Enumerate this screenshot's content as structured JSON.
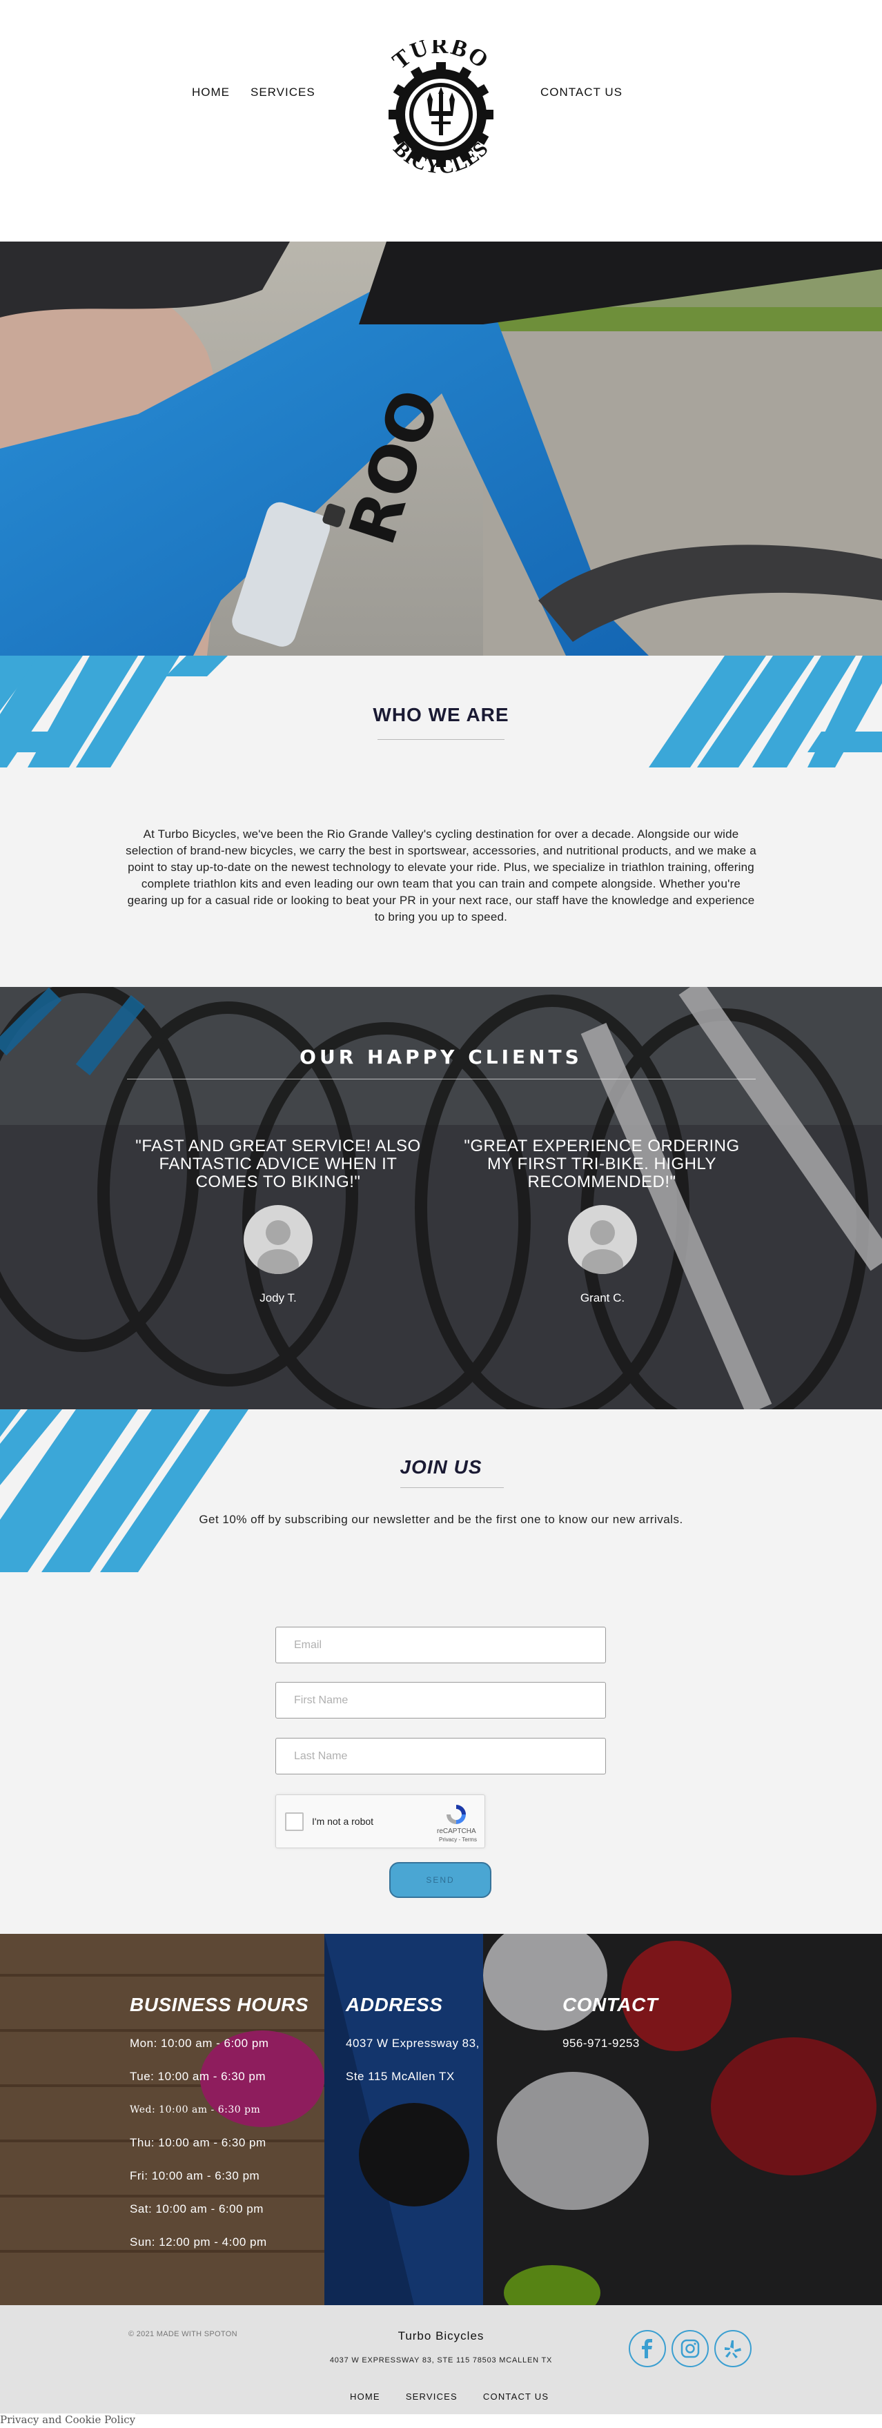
{
  "header": {
    "nav_left": [
      "HOME",
      "SERVICES"
    ],
    "nav_right": "CONTACT US",
    "logo_text_top": "TURBO",
    "logo_text_bottom": "BICYCLES"
  },
  "who": {
    "title": "WHO WE ARE",
    "body": "At Turbo Bicycles, we've been the Rio Grande Valley's cycling destination for over a decade. Alongside our wide selection of brand-new bicycles, we carry the best in sportswear, accessories, and nutritional products, and we make a point to stay up-to-date on the newest technology to elevate your ride. Plus, we specialize in triathlon training, offering complete triathlon kits and even leading our own team that you can train and compete alongside. Whether you're gearing up for a casual ride or looking to beat your PR in your next race, our staff have the knowledge and experience to bring you up to speed."
  },
  "clients": {
    "title": "OUR HAPPY CLIENTS",
    "testimonials": [
      {
        "quote": "\"FAST AND GREAT SERVICE! ALSO FANTASTIC ADVICE WHEN IT COMES TO BIKING!\"",
        "name": "Jody T."
      },
      {
        "quote": "\"GREAT EXPERIENCE ORDERING MY FIRST TRI-BIKE. HIGHLY RECOMMENDED!\"",
        "name": "Grant C."
      }
    ]
  },
  "join": {
    "title": "JOIN US",
    "subtitle": "Get 10% off by subscribing our newsletter and be the first one to know our new arrivals.",
    "email_placeholder": "Email",
    "first_name_placeholder": "First Name",
    "last_name_placeholder": "Last Name",
    "captcha_label": "I'm not a robot",
    "captcha_brand": "reCAPTCHA",
    "captcha_links": "Privacy - Terms",
    "send_label": "SEND"
  },
  "info": {
    "hours_heading": "BUSINESS HOURS",
    "hours": [
      "Mon: 10:00 am - 6:00 pm",
      "Tue: 10:00 am - 6:30 pm",
      "Wed: 10:00 am - 6:30 pm",
      "Thu: 10:00 am - 6:30 pm",
      "Fri: 10:00 am - 6:30 pm",
      "Sat: 10:00 am - 6:00 pm",
      "Sun: 12:00 pm - 4:00 pm"
    ],
    "address_heading": "ADDRESS",
    "address_lines": [
      "4037 W Expressway 83,",
      "Ste 115 McAllen TX"
    ],
    "contact_heading": "CONTACT",
    "phone": "956-971-9253"
  },
  "footer": {
    "copyright": "© 2021 MADE WITH SPOTON",
    "brand": "Turbo Bicycles",
    "address": "4037 W EXPRESSWAY 83, STE 115 78503 MCALLEN TX",
    "nav": [
      "HOME",
      "SERVICES",
      "CONTACT US"
    ],
    "social_icons": [
      "facebook-icon",
      "instagram-icon",
      "yelp-icon"
    ],
    "accent_color": "#3b9fd1"
  },
  "privacy_link": "Privacy and Cookie Policy"
}
